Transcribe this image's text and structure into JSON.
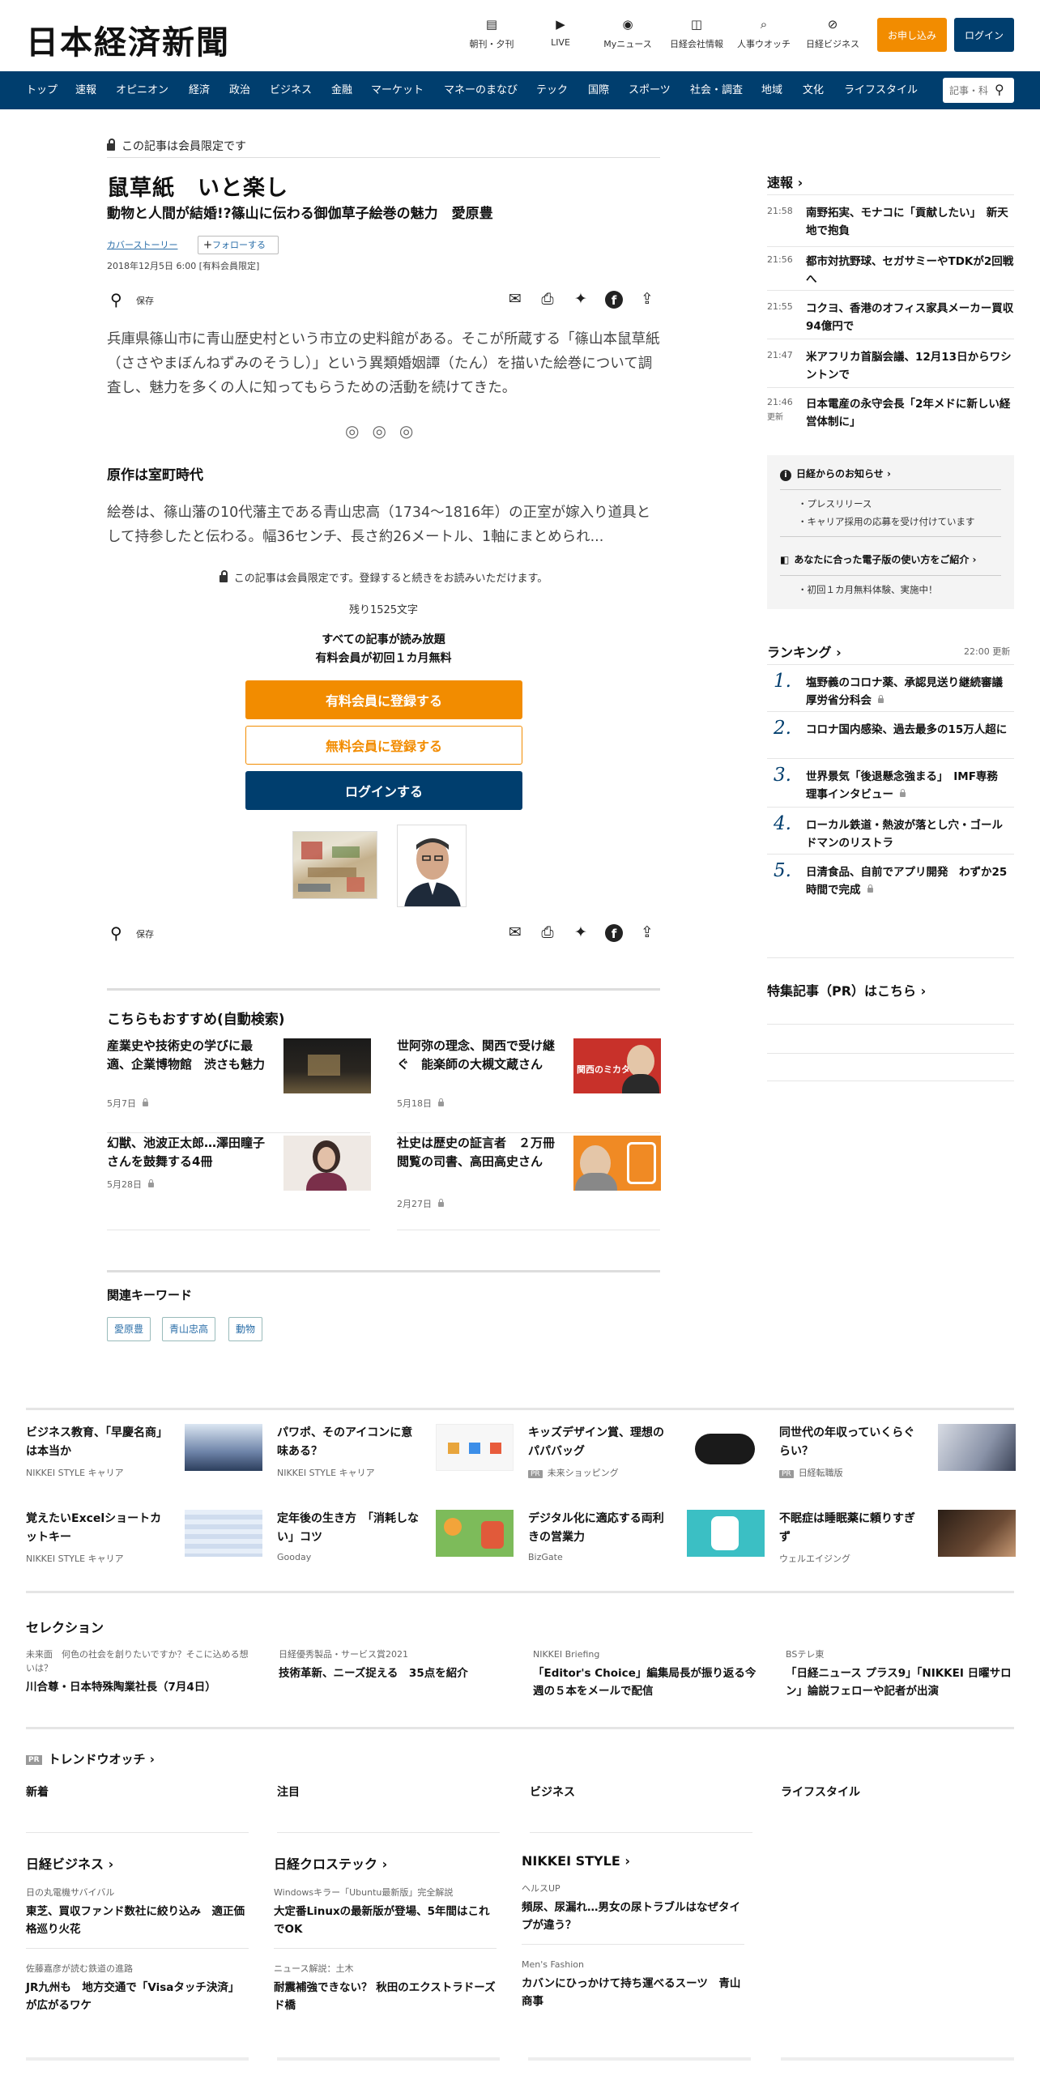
{
  "header": {
    "logo": "日本経済新聞",
    "icons": [
      {
        "label": "朝刊・夕刊",
        "icon": "newspaper-icon"
      },
      {
        "label": "LIVE",
        "icon": "video-icon"
      },
      {
        "label": "Myニュース",
        "icon": "user-icon"
      },
      {
        "label": "日経会社情報",
        "icon": "chart-icon"
      },
      {
        "label": "人事ウオッチ",
        "icon": "search-person-icon"
      },
      {
        "label": "日経ビジネス",
        "icon": "compass-icon"
      }
    ],
    "apply_label": "お申し込み",
    "login_label": "ログイン"
  },
  "nav": {
    "items": [
      "トップ",
      "速報",
      "オピニオン",
      "経済",
      "政治",
      "ビジネス",
      "金融",
      "マーケット",
      "マネーのまなび",
      "テック",
      "国際",
      "スポーツ",
      "社会・調査",
      "地域",
      "文化",
      "ライフスタイル"
    ],
    "search_placeholder": "記事・科"
  },
  "article": {
    "members_only": "この記事は会員限定です",
    "title": "鼠草紙　いと楽し",
    "subtitle": "動物と人間が結婚!?篠山に伝わる御伽草子絵巻の魅力　愛原豊",
    "category": "カバーストーリー",
    "follow": "フォローする",
    "date": "2018年12月5日 6:00 [有料会員限定]",
    "save_label": "保存",
    "lead": "兵庫県篠山市に青山歴史村という市立の史料館がある。そこが所蔵する「篠山本鼠草紙（ささやまぼんねずみのそうし）」という異類婚姻譚（たん）を描いた絵巻について調査し、魅力を多くの人に知ってもらうための活動を続けてきた。",
    "section_heading": "原作は室町時代",
    "body": "絵巻は、篠山藩の10代藩主である青山忠高（1734～1816年）の正室が嫁入り道具として持参したと伝わる。幅36センチ、長さ約26メートル、1軸にまとめられ...",
    "paywall_text": "この記事は会員限定です。登録すると続きをお読みいただけます。",
    "remaining": "残り1525文字",
    "all_read_1": "すべての記事が読み放題",
    "all_read_2": "有料会員が初回１カ月無料",
    "cta_paid": "有料会員に登録する",
    "cta_free": "無料会員に登録する",
    "cta_login": "ログインする"
  },
  "recommend": {
    "title": "こちらもおすすめ(自動検索)",
    "items": [
      {
        "title": "産業史や技術史の学びに最適、企業博物館　渋さも魅力",
        "date": "5月7日"
      },
      {
        "title": "世阿弥の理念、関西で受け継ぐ　能楽師の大槻文蔵さん",
        "date": "5月18日"
      },
      {
        "title": "幻獣、池波正太郎…澤田瞳子さんを鼓舞する4冊",
        "date": "5月28日"
      },
      {
        "title": "社史は歴史の証言者　２万冊閲覧の司書、高田高史さん",
        "date": "2月27日"
      }
    ],
    "kansai_label": "関西のミカタ"
  },
  "keywords": {
    "title": "関連キーワード",
    "items": [
      "愛原豊",
      "青山忠高",
      "動物"
    ]
  },
  "sidebar": {
    "news_title": "速報",
    "news": [
      {
        "time": "21:58",
        "headline": "南野拓実、モナコに「貢献したい」　新天地で抱負"
      },
      {
        "time": "21:56",
        "headline": "都市対抗野球、セガサミーやTDKが2回戦へ"
      },
      {
        "time": "21:55",
        "headline": "コクヨ、香港のオフィス家具メーカー買収　94億円で"
      },
      {
        "time": "21:47",
        "headline": "米アフリカ首脳会議、12月13日からワシントンで"
      },
      {
        "time": "21:46",
        "extra": "更新",
        "headline": "日本電産の永守会長「2年メドに新しい経営体制に」"
      }
    ],
    "notice_title": "日経からのお知らせ",
    "notice_items": [
      "プレスリリース",
      "キャリア採用の応募を受け付けています"
    ],
    "guide_title": "あなたに合った電子版の使い方をご紹介",
    "guide_items": [
      "初回１カ月無料体験、実施中！"
    ],
    "ranking_title": "ランキング",
    "ranking_time": "22:00  更新",
    "ranking": [
      {
        "num": "1.",
        "headline": "塩野義のコロナ薬、承認見送り継続審議　厚労省分科会"
      },
      {
        "num": "2.",
        "headline": "コロナ国内感染、過去最多の15万人超に"
      },
      {
        "num": "3.",
        "headline": "世界景気「後退懸念強まる」　IMF専務理事インタビュー"
      },
      {
        "num": "4.",
        "headline": "ローカル鉄道・熱波が落とし穴・ゴールドマンのリストラ"
      },
      {
        "num": "5.",
        "headline": "日清食品、自前でアプリ開発　わずか25時間で完成"
      }
    ],
    "pr_title": "特集記事（PR）はこちら"
  },
  "promos": [
    {
      "title": "ビジネス教育、「早慶名商」は本当か",
      "source": "NIKKEI STYLE キャリア"
    },
    {
      "title": "パワポ、そのアイコンに意味ある？",
      "source": "NIKKEI STYLE キャリア"
    },
    {
      "title": "キッズデザイン賞、理想のパパバッグ",
      "source": "未来ショッピング",
      "pr": "PR"
    },
    {
      "title": "同世代の年収っていくらぐらい？",
      "source": "日経転職版",
      "pr": "PR"
    },
    {
      "title": "覚えたいExcelショートカットキー",
      "source": "NIKKEI STYLE キャリア"
    },
    {
      "title": "定年後の生き方　「消耗しない」コツ",
      "source": "Gooday"
    },
    {
      "title": "デジタル化に適応する両利きの営業力",
      "source": "BizGate"
    },
    {
      "title": "不眠症は睡眠薬に頼りすぎず",
      "source": "ウェルエイジング"
    }
  ],
  "selection": {
    "title": "セレクション",
    "items": [
      {
        "kicker": "未来面　何色の社会を創りたいですか？そこに込める想いは？",
        "title": "川合尊・日本特殊陶業社長（7月4日）"
      },
      {
        "kicker": "日経優秀製品・サービス賞2021",
        "title": "技術革新、ニーズ捉える　35点を紹介"
      },
      {
        "kicker": "NIKKEI Briefing",
        "title": "「Editor's Choice」編集局長が振り返る今週の５本をメールで配信"
      },
      {
        "kicker": "BSテレ東",
        "title": "「日経ニュース プラス9」「NIKKEI 日曜サロン」論説フェローや記者が出演"
      }
    ]
  },
  "trend": {
    "pr": "PR",
    "title": "トレンドウオッチ",
    "categories": [
      "新着",
      "注目",
      "ビジネス",
      "ライフスタイル"
    ]
  },
  "columns": [
    {
      "title": "日経ビジネス",
      "items": [
        {
          "kicker": "日の丸電機サバイバル",
          "title": "東芝、買収ファンド数社に絞り込み　適正価格巡り火花"
        },
        {
          "kicker": "佐藤嘉彦が読む鉄道の進路",
          "title": "JR九州も　地方交通で「Visaタッチ決済」が広がるワケ"
        }
      ]
    },
    {
      "title": "日経クロステック",
      "items": [
        {
          "kicker": "Windowsキラー「Ubuntu最新版」完全解説",
          "title": "大定番Linuxの最新版が登場、5年間はこれでOK"
        },
        {
          "kicker": "ニュース解説：土木",
          "title": "耐震補強できない？ 秋田のエクストラドーズド橋"
        }
      ]
    },
    {
      "title": "NIKKEI STYLE",
      "items": [
        {
          "kicker": "ヘルスUP",
          "title": "頻尿、尿漏れ…男女の尿トラブルはなぜタイプが違う？"
        },
        {
          "kicker": "Men's Fashion",
          "title": "カバンにひっかけて持ち運べるスーツ　青山商事"
        }
      ]
    }
  ]
}
